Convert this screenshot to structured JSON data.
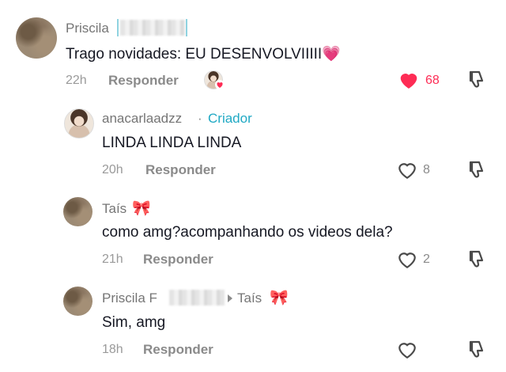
{
  "comments": [
    {
      "username": "Priscila",
      "text": "Trago novidades: EU DESENVOLVIIIII",
      "emoji": "💗",
      "time": "22h",
      "reply_label": "Responder",
      "likes": "68",
      "liked": true,
      "liked_by_creator": true
    },
    {
      "username": "anacarlaadzz",
      "creator_label": "Criador",
      "text": "LINDA LINDA LINDA",
      "time": "20h",
      "reply_label": "Responder",
      "likes": "8"
    },
    {
      "username": "Taís",
      "username_emoji": "🎀",
      "text": "como amg?acompanhando os videos dela?",
      "time": "21h",
      "reply_label": "Responder",
      "likes": "2"
    },
    {
      "username": "Priscila F",
      "reply_to": "Taís",
      "reply_to_emoji": "🎀",
      "text": "Sim, amg",
      "time": "18h",
      "reply_label": "Responder",
      "likes": ""
    }
  ],
  "colors": {
    "like_red": "#fe2c55",
    "creator_cyan": "#20a9c4",
    "muted_gray": "#8a8a8a"
  },
  "icons": [
    "heart-icon",
    "dislike-icon",
    "reply-arrow-icon",
    "bow-emoji",
    "pink-heart-emoji"
  ]
}
